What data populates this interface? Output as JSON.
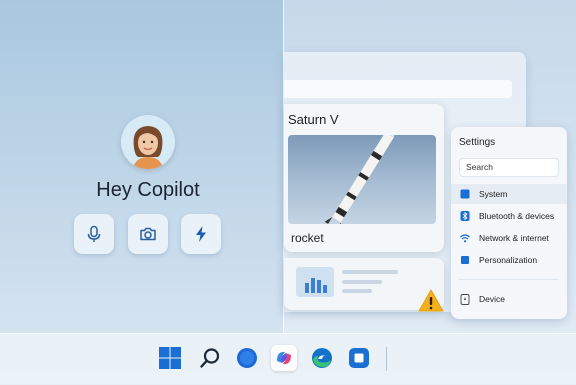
{
  "copilot": {
    "greeting": "Hey Copilot",
    "buttons": [
      "microphone-icon",
      "camera-icon",
      "lightning-icon"
    ]
  },
  "saturn_card": {
    "title": "Saturn V",
    "image_label": "rocket"
  },
  "settings": {
    "title": "Settings",
    "search_placeholder": "Search",
    "items": [
      {
        "label": "System",
        "icon": "system-icon"
      },
      {
        "label": "Bluetooth & devices",
        "icon": "bluetooth-icon"
      },
      {
        "label": "Network & internet",
        "icon": "wifi-icon"
      },
      {
        "label": "Personalization",
        "icon": "personalization-icon"
      }
    ],
    "device_label": "Device"
  },
  "taskbar": {
    "icons": [
      "start-icon",
      "search-icon",
      "copilot-icon",
      "browser-icon",
      "edge-icon",
      "store-icon"
    ]
  },
  "colors": {
    "accent": "#1a6fd4",
    "warning": "#f2b01e"
  }
}
